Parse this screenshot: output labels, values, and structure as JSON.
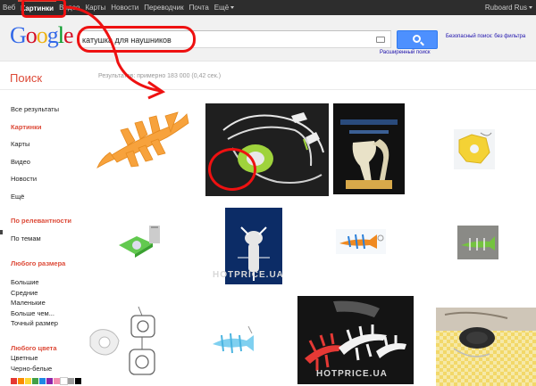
{
  "topbar": {
    "nav": [
      "Веб",
      "Картинки",
      "Видео",
      "Карты",
      "Новости",
      "Переводчик",
      "Почта",
      "Ещё"
    ],
    "user": "Ruboard Rus"
  },
  "logo": "Google",
  "search": {
    "query": "катушка для наушников",
    "advanced": "Расширенный поиск",
    "safe": "Безопасный поиск: без фильтра"
  },
  "page": {
    "heading": "Поиск",
    "stats": "Результатов: примерно 183 000 (0,42 сек.)"
  },
  "leftnav": {
    "items": [
      "Все результаты",
      "Картинки",
      "Карты",
      "Видео",
      "Новости",
      "Ещё"
    ],
    "sort_head": "По релевантности",
    "sort_items": [
      "По темам"
    ],
    "size_head": "Любого размера",
    "size_items": [
      "Большие",
      "Средние",
      "Маленькие",
      "Больше чем...",
      "Точный размер"
    ],
    "color_head": "Любого цвета",
    "color_items": [
      "Цветные",
      "Черно-белые"
    ],
    "swatch_colors": [
      "#e53935",
      "#fb8c00",
      "#fdd835",
      "#43a047",
      "#1e88e5",
      "#8e24aa",
      "#f48fb1",
      "#fff",
      "#9e9e9e",
      "#000"
    ]
  },
  "watermarks": [
    "HOTPRICE.UA",
    "HOTPRICE.UA"
  ],
  "images": [
    {
      "id": "orange-fishbone"
    },
    {
      "id": "green-earphone-winder"
    },
    {
      "id": "packaged-organizer"
    },
    {
      "id": "yellow-winder"
    },
    {
      "id": "green-cd-holder"
    },
    {
      "id": "white-cable-organizer"
    },
    {
      "id": "orange-fish-clip"
    },
    {
      "id": "green-fish-clip"
    },
    {
      "id": "cable-winders-set"
    },
    {
      "id": "blue-fish-clip"
    },
    {
      "id": "fishbones-colored"
    },
    {
      "id": "earphone-in-case"
    }
  ],
  "colors": {
    "accent_red": "#dd4b39",
    "link_blue": "#1a0dab",
    "search_btn": "#4d90fe",
    "annotation": "#e11111"
  }
}
